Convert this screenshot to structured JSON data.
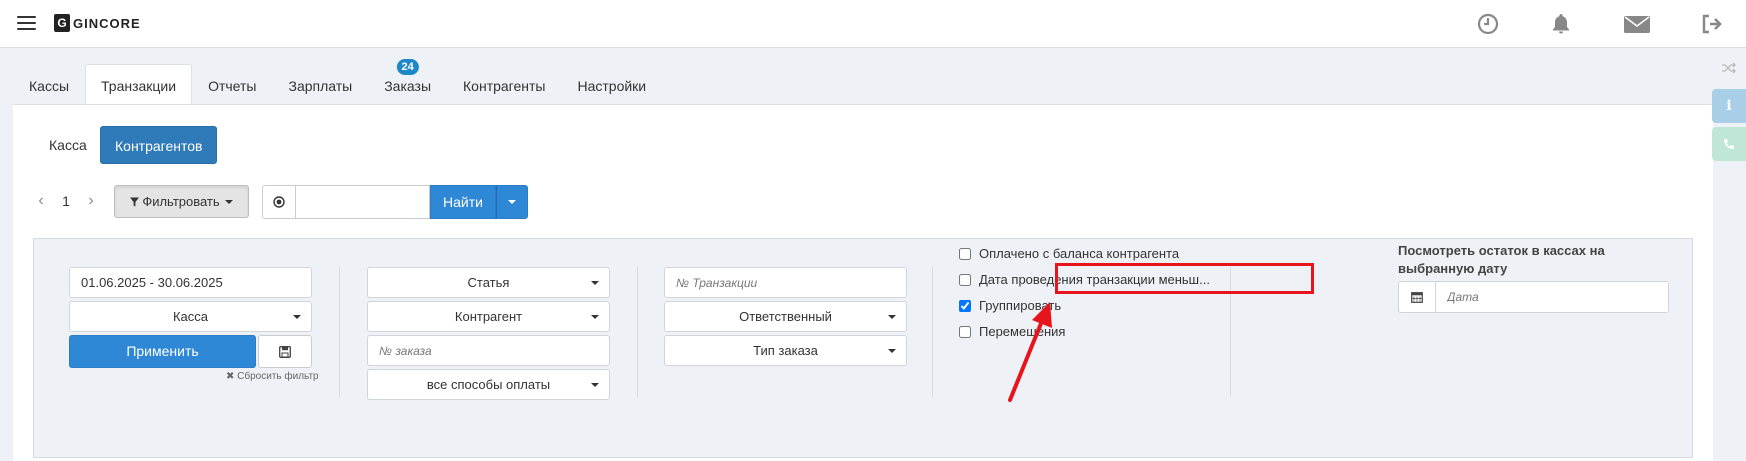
{
  "header": {
    "logo_text": "GINCORE",
    "logo_mark": "G",
    "icons": [
      "clock-icon",
      "bell-icon",
      "envelope-icon",
      "logout-icon"
    ]
  },
  "tabs": [
    {
      "label": "Кассы"
    },
    {
      "label": "Транзакции",
      "active": true
    },
    {
      "label": "Отчеты"
    },
    {
      "label": "Зарплаты"
    },
    {
      "label": "Заказы",
      "badge": "24"
    },
    {
      "label": "Контрагенты"
    },
    {
      "label": "Настройки"
    }
  ],
  "subtabs": {
    "cash": "Касса",
    "counterparties": "Контрагентов"
  },
  "pager": {
    "page": "1"
  },
  "toolbar": {
    "filter_label": "Фильтровать",
    "search_placeholder": "",
    "find_label": "Найти"
  },
  "filters": {
    "date_range": "01.06.2025 - 30.06.2025",
    "cashbox": "Касса",
    "apply_label": "Применить",
    "reset_label": "Сбросить фильтр",
    "article": "Статья",
    "counterparty": "Контрагент",
    "order_no_placeholder": "№ заказа",
    "payment_methods": "все способы оплаты",
    "transaction_no_placeholder": "№ Транзакции",
    "responsible": "Ответственный",
    "order_type": "Тип заказа",
    "checkboxes": [
      {
        "label": "Оплачено с баланса контрагента",
        "checked": false
      },
      {
        "label": "Дата проведения транзакции меньш...",
        "checked": false
      },
      {
        "label": "Группировать",
        "checked": true
      },
      {
        "label": "Перемещения",
        "checked": false
      }
    ],
    "balance_title": "Посмотреть остаток в кассах на выбранную дату",
    "date_placeholder": "Дата"
  },
  "colors": {
    "primary": "#2f88d6",
    "tab_badge": "#1e88c6",
    "highlight": "#e8141c",
    "side_info": "#a9cfe8",
    "side_phone": "#bfe6d6"
  }
}
